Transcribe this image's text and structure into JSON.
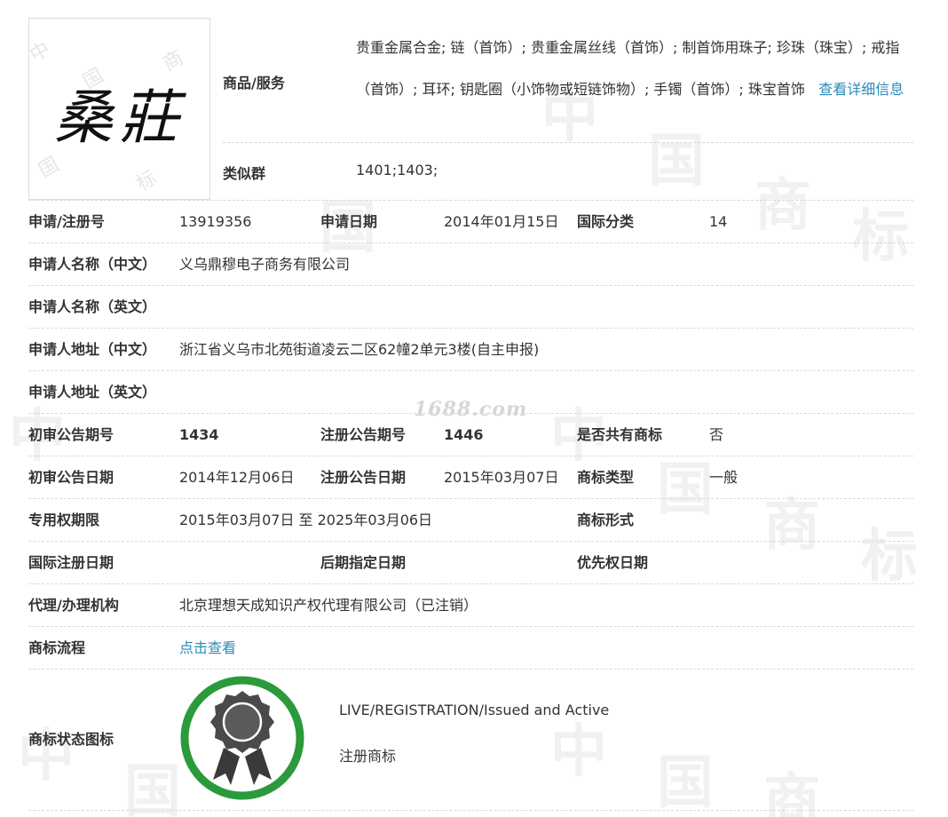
{
  "trademark": {
    "logo_text": "桑莊",
    "goods_label": "商品/服务",
    "goods_text": "贵重金属合金; 链（首饰）; 贵重金属丝线（首饰）; 制首饰用珠子; 珍珠（珠宝）; 戒指（首饰）; 耳环; 钥匙圈（小饰物或短链饰物）; 手镯（首饰）; 珠宝首饰",
    "goods_more": "查看详细信息",
    "similar_label": "类似群",
    "similar_value": "1401;1403;"
  },
  "rows": [
    {
      "label1": "申请/注册号",
      "value1": "13919356",
      "label2": "申请日期",
      "value2": "2014年01月15日",
      "label3": "国际分类",
      "value3": "14"
    },
    {
      "label1": "申请人名称（中文）",
      "value1": "义乌鼎穆电子商务有限公司"
    },
    {
      "label1": "申请人名称（英文）",
      "value1": ""
    },
    {
      "label1": "申请人地址（中文）",
      "value1": "浙江省义乌市北苑街道凌云二区62幢2单元3楼(自主申报)"
    },
    {
      "label1": "申请人地址（英文）",
      "value1": ""
    },
    {
      "label1": "初审公告期号",
      "value1": "1434",
      "label2": "注册公告期号",
      "value2": "1446",
      "label3": "是否共有商标",
      "value3": "否"
    },
    {
      "label1": "初审公告日期",
      "value1": "2014年12月06日",
      "label2": "注册公告日期",
      "value2": "2015年03月07日",
      "label3": "商标类型",
      "value3": "一般"
    },
    {
      "label1": "专用权期限",
      "value1": "2015年03月07日 至 2025年03月06日",
      "label3": "商标形式",
      "value3": ""
    },
    {
      "label1": "国际注册日期",
      "value1": "",
      "label2": "后期指定日期",
      "value2": "",
      "label3": "优先权日期",
      "value3": ""
    },
    {
      "label1": "代理/办理机构",
      "value1": "北京理想天成知识产权代理有限公司（已注销）"
    },
    {
      "label1": "商标流程",
      "value1": "点击查看"
    }
  ],
  "status": {
    "label": "商标状态图标",
    "en": "LIVE/REGISTRATION/Issued and Active",
    "cn": "注册商标",
    "ring_color": "#2a9a3c"
  },
  "watermarks": {
    "site": "1688.com",
    "tile_a": "中",
    "tile_b": "国",
    "tile_c": "商",
    "tile_d": "标"
  },
  "colors": {
    "link": "#2b8ab8",
    "border": "#d8d8d8"
  }
}
